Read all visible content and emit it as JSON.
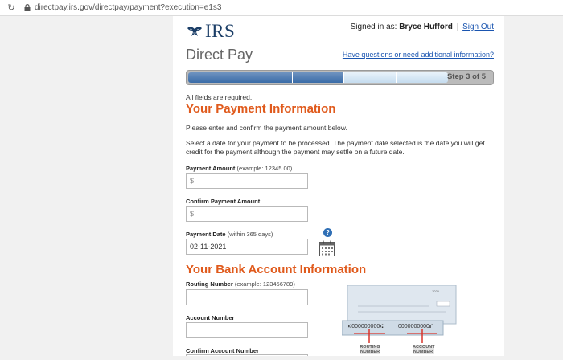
{
  "browser": {
    "url": "directpay.irs.gov/directpay/payment?execution=e1s3"
  },
  "header": {
    "logo_text": "IRS",
    "signed_in_prefix": "Signed in as:",
    "user_name": "Bryce Hufford",
    "sign_out": "Sign Out",
    "separator": "|"
  },
  "page": {
    "title": "Direct Pay",
    "help_link": "Have questions or need additional information?"
  },
  "progress": {
    "label": "Step 3 of 5",
    "current_step": 3,
    "total_steps": 5
  },
  "form": {
    "required_note": "All fields are required.",
    "payment_section": {
      "heading": "Your Payment Information",
      "intro": "Please enter and confirm the payment amount below.",
      "date_note": "Select a date for your payment to be processed. The payment date selected is the date you will get credit for the payment although the payment may settle on a future date.",
      "amount_label": "Payment Amount",
      "amount_hint": "(example: 12345.00)",
      "amount_value": "",
      "amount_prefix": "$",
      "confirm_amount_label": "Confirm Payment Amount",
      "confirm_amount_value": "",
      "confirm_amount_prefix": "$",
      "date_label": "Payment Date",
      "date_hint": "(within 365 days)",
      "date_value": "02-11-2021"
    },
    "bank_section": {
      "heading": "Your Bank Account Information",
      "routing_label": "Routing Number",
      "routing_hint": "(example: 123456789)",
      "routing_value": "",
      "account_label": "Account Number",
      "account_value": "",
      "confirm_account_label": "Confirm Account Number",
      "confirm_account_value": ""
    }
  },
  "check_illustration": {
    "check_number": "1025",
    "routing_digits": "⑆000000000⑆",
    "account_digits": "0000000000⑈",
    "routing_caption": "ROUTING NUMBER",
    "account_caption": "ACCOUNT NUMBER"
  },
  "colors": {
    "heading_orange": "#e05a1c",
    "link_blue": "#1a55b0",
    "irs_navy": "#1b3e67",
    "progress_done": "#3a6ba7",
    "progress_todo": "#c5dcef"
  }
}
